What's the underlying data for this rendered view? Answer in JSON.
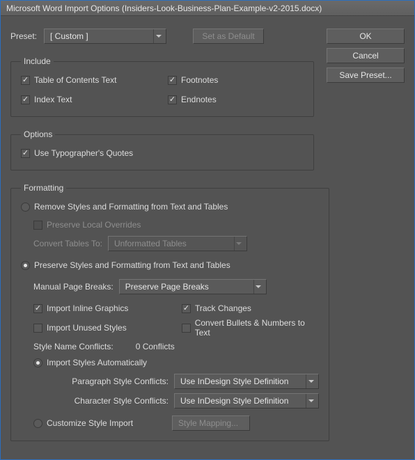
{
  "title": "Microsoft Word Import Options (Insiders-Look-Business-Plan-Example-v2-2015.docx)",
  "preset": {
    "label": "Preset:",
    "value": "[ Custom ]",
    "setDefault": "Set as Default"
  },
  "buttons": {
    "ok": "OK",
    "cancel": "Cancel",
    "savePreset": "Save Preset..."
  },
  "include": {
    "legend": "Include",
    "toc": "Table of Contents Text",
    "index": "Index Text",
    "footnotes": "Footnotes",
    "endnotes": "Endnotes"
  },
  "options": {
    "legend": "Options",
    "typographers": "Use Typographer's Quotes"
  },
  "formatting": {
    "legend": "Formatting",
    "removeStyles": "Remove Styles and Formatting from Text and Tables",
    "preserveLocal": "Preserve Local Overrides",
    "convertTablesLabel": "Convert Tables To:",
    "convertTablesValue": "Unformatted Tables",
    "preserveStyles": "Preserve Styles and Formatting from Text and Tables",
    "manualBreaksLabel": "Manual Page Breaks:",
    "manualBreaksValue": "Preserve Page Breaks",
    "importInline": "Import Inline Graphics",
    "trackChanges": "Track Changes",
    "importUnused": "Import Unused Styles",
    "convertBullets": "Convert Bullets & Numbers to Text",
    "conflictsLabel": "Style Name Conflicts:",
    "conflictsValue": "0 Conflicts",
    "importAuto": "Import Styles Automatically",
    "paraConflictsLabel": "Paragraph Style Conflicts:",
    "paraConflictsValue": "Use InDesign Style Definition",
    "charConflictsLabel": "Character Style Conflicts:",
    "charConflictsValue": "Use InDesign Style Definition",
    "customizeImport": "Customize Style Import",
    "styleMapping": "Style Mapping..."
  }
}
